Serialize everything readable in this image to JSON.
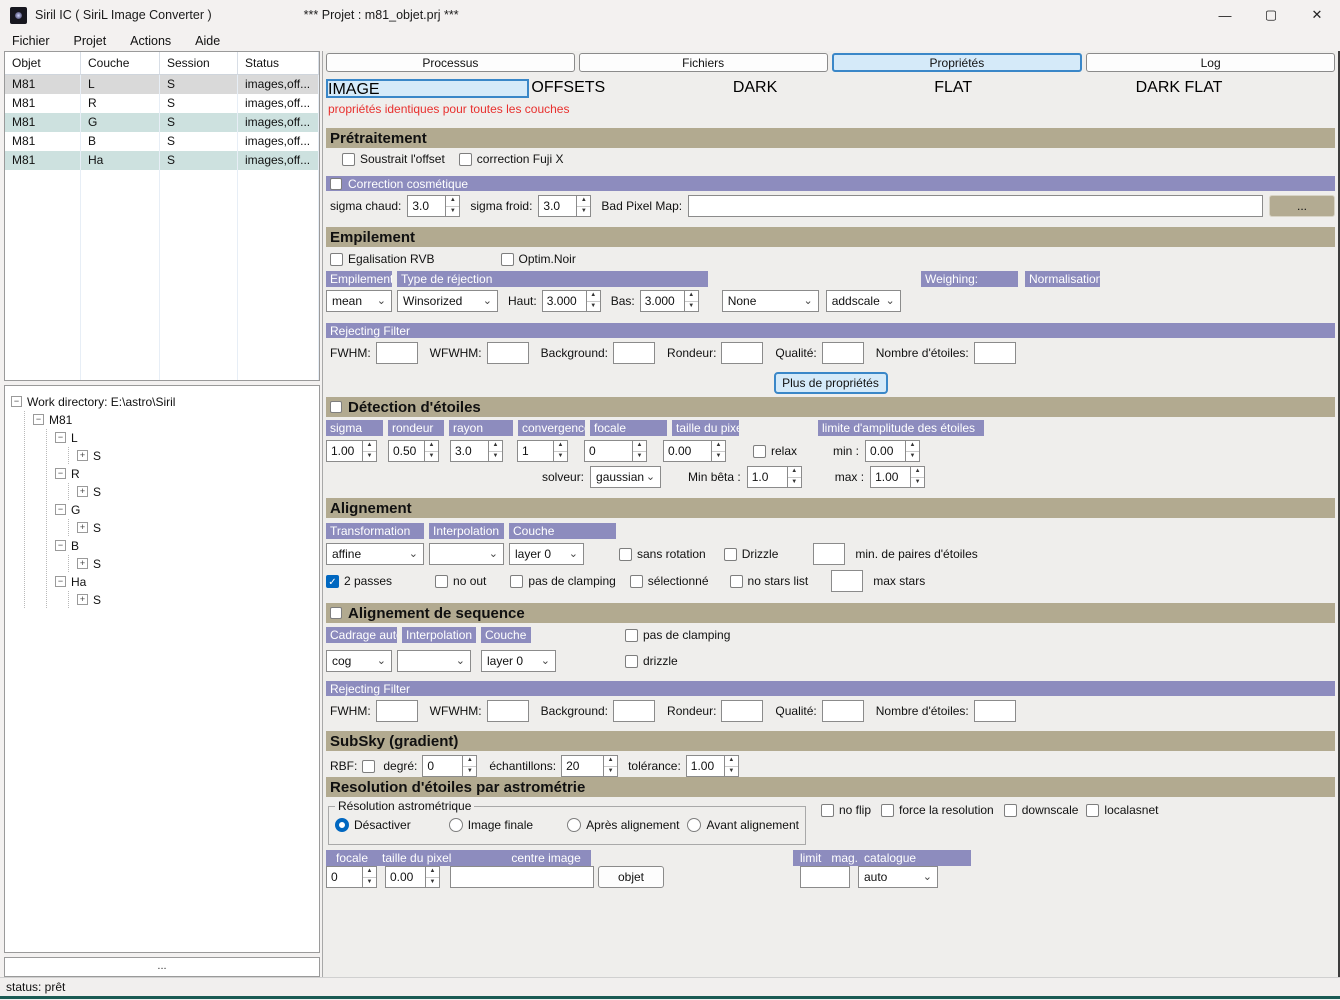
{
  "window": {
    "title": "Siril IC  ( SiriL Image Converter )",
    "project": "*** Projet : m81_objet.prj ***",
    "minimize_icon": "—",
    "maximize_icon": "▢",
    "close_icon": "✕"
  },
  "menu": {
    "items": [
      "Fichier",
      "Projet",
      "Actions",
      "Aide"
    ]
  },
  "colors": {
    "section_header": "#b2aa90",
    "purple_bar": "#8d8cbe",
    "selected_tab_bg": "#d5eaf9",
    "selected_tab_border": "#3a87c8",
    "notice_red": "#e8302e",
    "row_selected": "#d9d9d9",
    "row_alt_teal": "#cde1df",
    "accent_blue": "#0067c0",
    "bottom_edge": "#1b5b54"
  },
  "table": {
    "columns": [
      "Objet",
      "Couche",
      "Session",
      "Status"
    ],
    "rows": [
      {
        "objet": "M81",
        "couche": "L",
        "session": "S",
        "status": "images,off..."
      },
      {
        "objet": "M81",
        "couche": "R",
        "session": "S",
        "status": "images,off..."
      },
      {
        "objet": "M81",
        "couche": "G",
        "session": "S",
        "status": "images,off..."
      },
      {
        "objet": "M81",
        "couche": "B",
        "session": "S",
        "status": "images,off..."
      },
      {
        "objet": "M81",
        "couche": "Ha",
        "session": "S",
        "status": "images,off..."
      }
    ]
  },
  "tree": {
    "root": "Work directory: E:\\astro\\Siril",
    "object": "M81",
    "channels": [
      {
        "label": "L",
        "child": "S"
      },
      {
        "label": "R",
        "child": "S"
      },
      {
        "label": "G",
        "child": "S"
      },
      {
        "label": "B",
        "child": "S"
      },
      {
        "label": "Ha",
        "child": "S"
      }
    ]
  },
  "more_dots": "...",
  "status": "status: prêt",
  "tabs": {
    "items": [
      "Processus",
      "Fichiers",
      "Propriétés",
      "Log"
    ],
    "active": "Propriétés"
  },
  "subtabs": {
    "items": [
      "IMAGE",
      "OFFSETS",
      "DARK",
      "FLAT",
      "DARK FLAT"
    ],
    "active": "IMAGE"
  },
  "notice": "propriétés identiques pour toutes les couches",
  "pre": {
    "title": "Prétraitement",
    "cb_offset": "Soustrait l'offset",
    "cb_fuji": "correction Fuji X",
    "cosmetic": "Correction cosmétique",
    "sigma_chaud": "sigma chaud:",
    "sigma_chaud_value": "3.0",
    "sigma_froid": "sigma froid:",
    "sigma_froid_value": "3.0",
    "bpm": "Bad Pixel Map:",
    "browse": "..."
  },
  "stack": {
    "title": "Empilement",
    "cb_rvb": "Egalisation RVB",
    "cb_noir": "Optim.Noir",
    "col_method": "Empilement",
    "col_rejection": "Type de réjection",
    "col_weighing": "Weighing:",
    "col_norm": "Normalisation",
    "method": "mean",
    "rejection": "Winsorized",
    "haut": "Haut:",
    "haut_value": "3.000",
    "bas": "Bas:",
    "bas_value": "3.000",
    "weighing": "None",
    "norm": "addscale"
  },
  "filter1": {
    "title": "Rejecting Filter",
    "fwhm": "FWHM:",
    "wfwhm": "WFWHM:",
    "background": "Background:",
    "rondeur": "Rondeur:",
    "qualite": "Qualité:",
    "etoiles": "Nombre d'étoiles:"
  },
  "more_props": "Plus de propriétés",
  "detect": {
    "title": "Détection d'étoiles",
    "col_sigma": "sigma",
    "col_rondeur": "rondeur",
    "col_rayon": "rayon",
    "col_conv": "convergence",
    "col_focale": "focale",
    "col_pixel": "taille du pixel",
    "col_limite": "limite d'amplitude des étoiles",
    "sigma": "1.00",
    "rondeur": "0.50",
    "rayon": "3.0",
    "conv": "1",
    "focale": "0",
    "pixel": "0.00",
    "relax": "relax",
    "min_label": "min :",
    "min": "0.00",
    "solveur_label": "solveur:",
    "solveur": "gaussian",
    "beta_label": "Min bêta :",
    "beta": "1.0",
    "max_label": "max :",
    "max": "1.00"
  },
  "align": {
    "title": "Alignement",
    "col_transfo": "Transformation",
    "col_interp": "Interpolation",
    "col_couche": "Couche",
    "transfo": "affine",
    "interp": "",
    "couche": "layer 0",
    "cb_rotation": "sans rotation",
    "cb_drizzle": "Drizzle",
    "min_pairs": "min. de paires d'étoiles",
    "cb_2passes": "2 passes",
    "cb_noout": "no out",
    "cb_clamping": "pas de clamping",
    "cb_sel": "sélectionné",
    "cb_nostars": "no stars list",
    "max_stars": "max  stars"
  },
  "seqalign": {
    "title": "Alignement de sequence",
    "col_cadrage": "Cadrage auto",
    "col_interp": "Interpolation",
    "col_couche": "Couche",
    "cadrage": "cog",
    "interp": "",
    "couche": "layer 0",
    "cb_clamping": "pas de clamping",
    "cb_drizzle": "drizzle"
  },
  "filter2": {
    "title": "Rejecting Filter",
    "fwhm": "FWHM:",
    "wfwhm": "WFWHM:",
    "background": "Background:",
    "rondeur": "Rondeur:",
    "qualite": "Qualité:",
    "etoiles": "Nombre d'étoiles:"
  },
  "subsky": {
    "title": "SubSky (gradient)",
    "rbf": "RBF:",
    "degre": "degré:",
    "degre_value": "0",
    "ech": "échantillons:",
    "ech_value": "20",
    "tol": "tolérance:",
    "tol_value": "1.00"
  },
  "astro": {
    "title": "Resolution d'étoiles par astrométrie",
    "group": "Résolution astrométrique",
    "r_disable": "Désactiver",
    "r_final": "Image finale",
    "r_after": "Après alignement",
    "r_before": "Avant alignement",
    "cb_noflip": "no flip",
    "cb_force": "force la resolution",
    "cb_downscale": "downscale",
    "cb_local": "localasnet",
    "col_focale": "focale",
    "col_pixel": "taille du pixel",
    "col_centre": "centre image",
    "focale": "0",
    "pixel": "0.00",
    "objet": "objet",
    "col_limit": "limit",
    "col_mag": "mag.",
    "col_catalogue": "catalogue",
    "catalogue": "auto"
  }
}
